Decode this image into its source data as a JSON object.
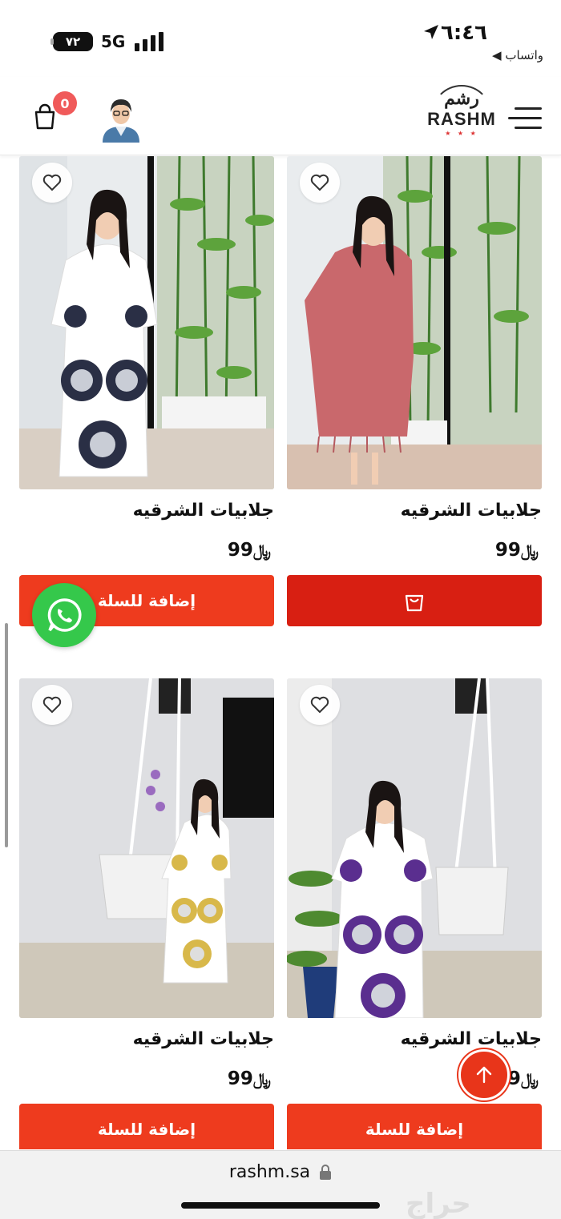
{
  "status_bar": {
    "battery": "٧٢",
    "network": "5G",
    "time": "٦:٤٦",
    "back_app": "◀ واتساب"
  },
  "header": {
    "cart_count": "0",
    "logo_script": "رشم",
    "logo_text": "RASHM"
  },
  "products": [
    {
      "title": "جلابيات الشرقيه",
      "price": "99",
      "currency": "﷼",
      "button": "إضافة للسلة",
      "dress_color": "#ffffff",
      "pattern_color": "#2a2f45"
    },
    {
      "title": "جلابيات الشرقيه",
      "price": "99",
      "currency": "﷼",
      "button": "",
      "dress_color": "#c9686c",
      "pattern_color": "#b55a5f"
    },
    {
      "title": "جلابيات الشرقيه",
      "price": "99",
      "currency": "﷼",
      "button": "إضافة للسلة",
      "dress_color": "#ffffff",
      "pattern_color": "#d8b84a"
    },
    {
      "title": "جلابيات الشرقيه",
      "price": "99",
      "currency": "﷼",
      "button": "إضافة للسلة",
      "dress_color": "#ffffff",
      "pattern_color": "#5a2e8f"
    }
  ],
  "url_bar": {
    "domain": "rashm.sa"
  },
  "watermark": "حراج",
  "colors": {
    "accent": "#ee3b1e",
    "whatsapp": "#35c84b",
    "badge": "#f05a5a"
  }
}
